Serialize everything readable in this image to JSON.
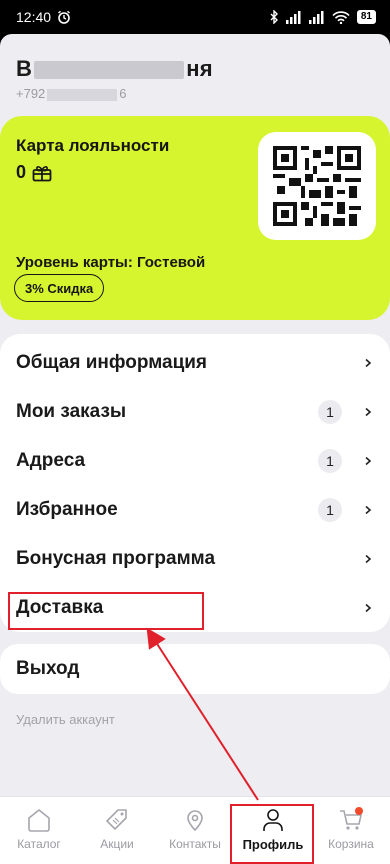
{
  "status_bar": {
    "time": "12:40",
    "battery": "81"
  },
  "user": {
    "name_start": "В",
    "name_end": "ня",
    "phone_prefix": "+792",
    "phone_suffix": "6"
  },
  "loyalty": {
    "title": "Карта лояльности",
    "points": "0",
    "card_level": "Уровень карты: Гостевой",
    "discount": "3% Скидка",
    "accent_color": "#d6f52f"
  },
  "menu": [
    {
      "label": "Общая информация",
      "count": ""
    },
    {
      "label": "Мои заказы",
      "count": "1"
    },
    {
      "label": "Адреса",
      "count": "1"
    },
    {
      "label": "Избранное",
      "count": "1"
    },
    {
      "label": "Бонусная программа",
      "count": ""
    },
    {
      "label": "Доставка",
      "count": ""
    }
  ],
  "logout": "Выход",
  "delete_account": "Удалить аккаунт",
  "tabs": [
    {
      "label": "Каталог",
      "icon": "home-icon"
    },
    {
      "label": "Акции",
      "icon": "tag-icon"
    },
    {
      "label": "Контакты",
      "icon": "location-pin-icon"
    },
    {
      "label": "Профиль",
      "icon": "user-icon"
    },
    {
      "label": "Корзина",
      "icon": "cart-icon"
    }
  ],
  "annotation_color": "#e0202a"
}
